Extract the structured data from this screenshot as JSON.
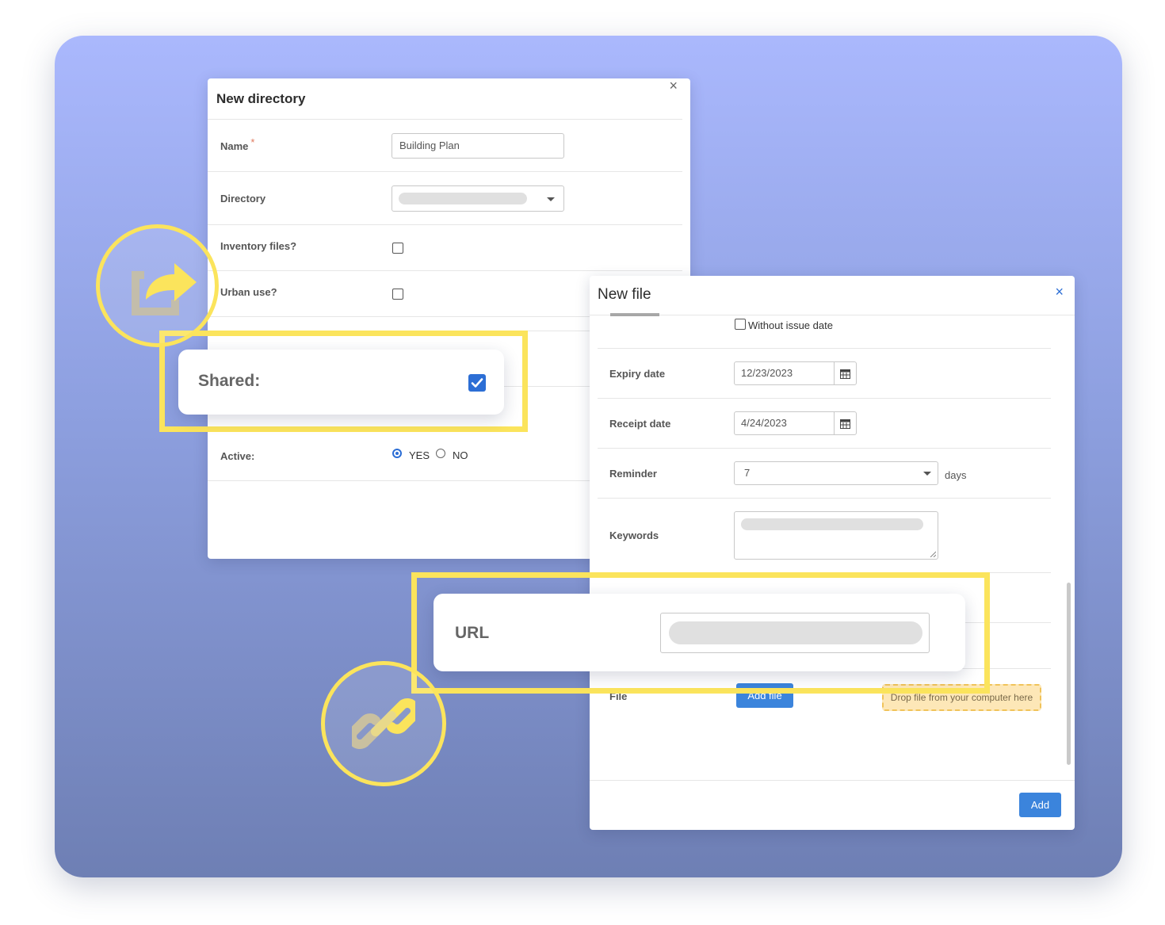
{
  "colors": {
    "accent": "#2c6ed5",
    "highlight": "#fbe45c",
    "button": "#3b84dc",
    "dropzone": "#fde7b7"
  },
  "directory_dialog": {
    "title": "New directory",
    "close_icon": "×",
    "name_label": "Name",
    "required_mark": "*",
    "name_value": "Building Plan",
    "directory_label": "Directory",
    "inventory_label": "Inventory files?",
    "urban_label": "Urban use?",
    "active_label": "Active:",
    "active_yes": "YES",
    "active_no": "NO"
  },
  "shared_callout": {
    "label": "Shared:",
    "checked": true
  },
  "file_dialog": {
    "title": "New file",
    "close_icon": "×",
    "without_issue_date": "Without issue date",
    "expiry_label": "Expiry date",
    "expiry_value": "12/23/2023",
    "receipt_label": "Receipt date",
    "receipt_value": "4/24/2023",
    "reminder_label": "Reminder",
    "reminder_value": "7",
    "reminder_unit": "days",
    "keywords_label": "Keywords",
    "file_label": "File",
    "add_file_button": "Add file",
    "dropzone_text": "Drop file from your computer here",
    "add_button": "Add"
  },
  "url_callout": {
    "label": "URL"
  },
  "icons": {
    "share": "share-icon",
    "link": "link-icon",
    "calendar": "calendar-icon"
  }
}
